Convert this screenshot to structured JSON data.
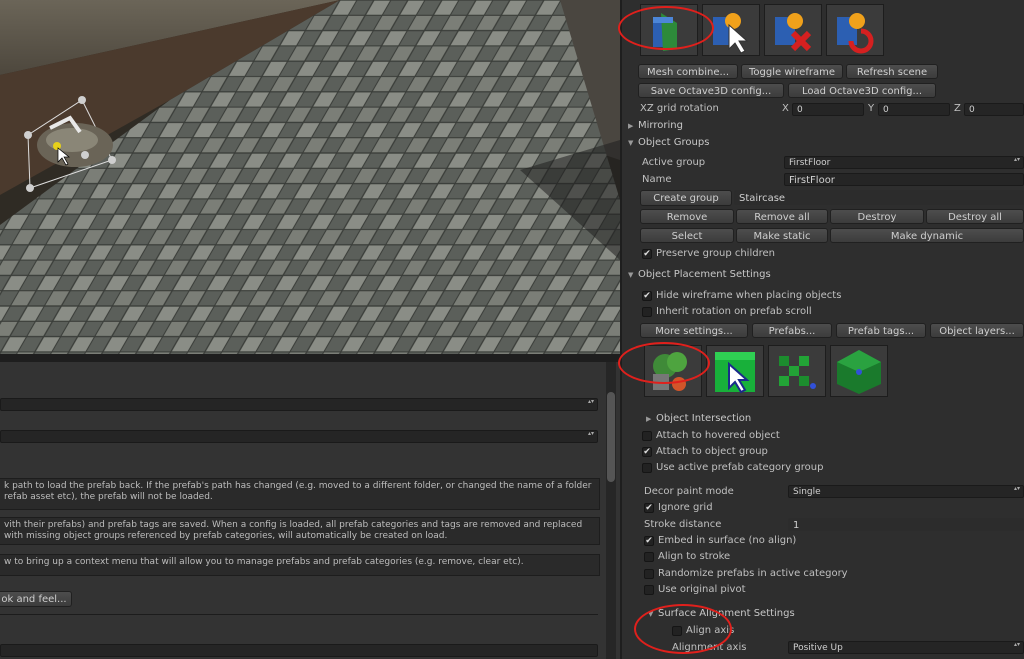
{
  "toolbar": {
    "mesh_combine": "Mesh combine...",
    "toggle_wireframe": "Toggle wireframe",
    "refresh_scene": "Refresh scene",
    "save_config": "Save Octave3D config...",
    "load_config": "Load Octave3D config..."
  },
  "xz_grid": {
    "label": "XZ grid rotation",
    "x_label": "X",
    "x_value": "0",
    "y_label": "Y",
    "y_value": "0",
    "z_label": "Z",
    "z_value": "0"
  },
  "mirroring": {
    "label": "Mirroring"
  },
  "object_groups": {
    "title": "Object Groups",
    "active_group_label": "Active group",
    "active_group_value": "FirstFloor",
    "name_label": "Name",
    "name_value": "FirstFloor",
    "create_group": "Create group",
    "new_group_name": "Staircase",
    "remove": "Remove",
    "remove_all": "Remove all",
    "destroy": "Destroy",
    "destroy_all": "Destroy all",
    "select": "Select",
    "make_static": "Make static",
    "make_dynamic": "Make dynamic",
    "preserve_children": "Preserve group children"
  },
  "placement": {
    "title": "Object Placement Settings",
    "hide_wireframe": "Hide wireframe when placing objects",
    "inherit_rotation": "Inherit rotation on prefab scroll",
    "more_settings": "More settings...",
    "prefabs": "Prefabs...",
    "prefab_tags": "Prefab tags...",
    "object_layers": "Object layers..."
  },
  "intersection": {
    "title": "Object Intersection",
    "attach_hovered": "Attach to hovered object",
    "attach_group": "Attach to object group",
    "use_active_category": "Use active prefab category group"
  },
  "decor": {
    "mode_label": "Decor paint mode",
    "mode_value": "Single",
    "ignore_grid": "Ignore grid",
    "stroke_label": "Stroke distance",
    "stroke_value": "1",
    "embed": "Embed in surface (no align)",
    "align_stroke": "Align to stroke",
    "randomize": "Randomize prefabs in active category",
    "original_pivot": "Use original pivot"
  },
  "surface": {
    "title": "Surface Alignment Settings",
    "align_axis": "Align axis",
    "axis_label": "Alignment axis",
    "axis_value": "Positive Up"
  },
  "bottom_panel": {
    "text1": "k path to load the prefab back. If the prefab's path has changed (e.g. moved to a different folder, or changed the name of a folder refab asset etc), the prefab will not be loaded.",
    "text2": "vith their prefabs) and prefab tags are saved. When a config is loaded, all prefab categories and tags are removed and replaced with missing object groups referenced by prefab categories, will automatically be created on load.",
    "text3": "w to bring up a context menu that will allow you to manage prefabs and prefab categories (e.g. remove, clear etc).",
    "look_button": "ok and feel..."
  },
  "checks": {
    "mark": "✔"
  },
  "colors": {
    "highlight": "#e0201c",
    "panel": "#2e2e2e"
  }
}
